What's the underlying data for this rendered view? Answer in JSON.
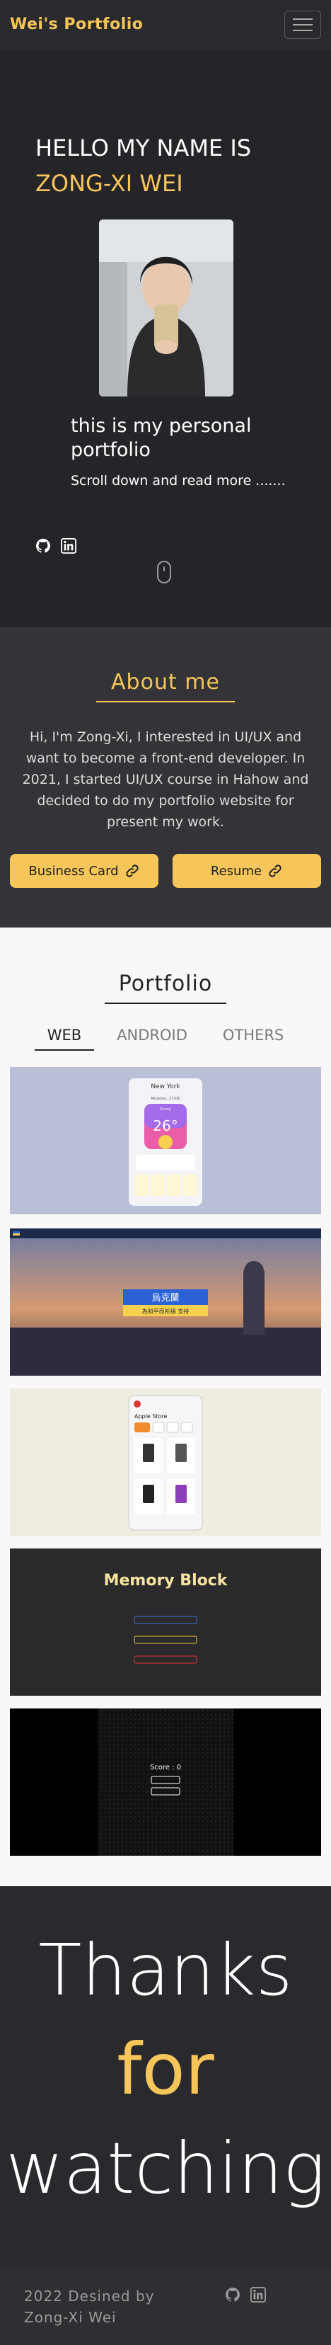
{
  "navbar": {
    "brand": "Wei's Portfolio"
  },
  "hero": {
    "greeting": "HELLO MY NAME IS",
    "name": "ZONG-XI WEI",
    "intro": "this is my personal portfolio",
    "scroll_hint": "Scroll down and read more ......."
  },
  "about": {
    "title": "About me",
    "text": "Hi, I'm Zong-Xi, I interested in UI/UX and want to become a front-end developer. In 2021, I started UI/UX course in Hahow and decided to do my portfolio website for present my work.",
    "business_card_label": "Business Card",
    "resume_label": "Resume"
  },
  "portfolio": {
    "title": "Portfolio",
    "tabs": [
      "WEB",
      "ANDROID",
      "OTHERS"
    ],
    "active_tab": "WEB",
    "weather": {
      "city": "New York",
      "date": "Monday, 27/06",
      "condition": "Sunny",
      "temp": "26°"
    },
    "ukraine": {
      "banner": "烏克蘭",
      "subtitle": "為和平而祈禱 支持"
    },
    "apple": {
      "title": "Apple Store"
    },
    "memory": {
      "title": "Memory Block"
    },
    "game": {
      "score": "Score : 0"
    }
  },
  "thanks": {
    "line1": "Thanks",
    "line2": "for",
    "line3": "watching"
  },
  "footer": {
    "line1": "2022 Desined by",
    "line2": "Zong-Xi Wei"
  },
  "colors": {
    "accent": "#f7c65a",
    "dark": "#252529",
    "section": "#343438"
  }
}
